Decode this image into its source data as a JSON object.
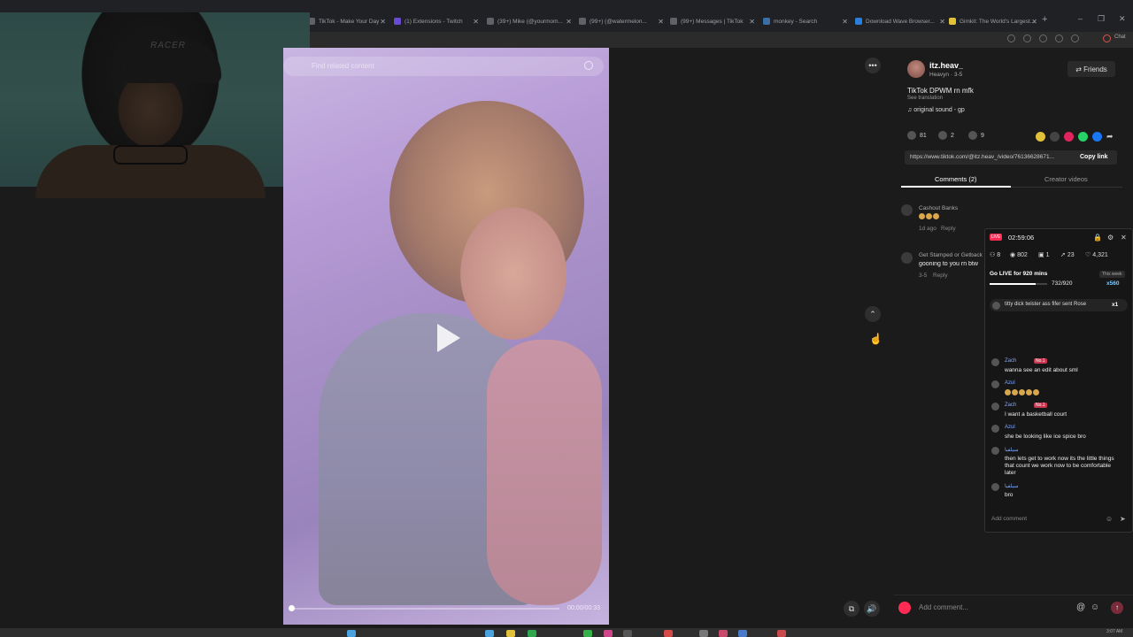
{
  "browser": {
    "tabs": [
      {
        "label": "TikTok - Make Your Day"
      },
      {
        "label": "(1) Extensions - Twitch"
      },
      {
        "label": "(39+) Mike (@yourmom..."
      },
      {
        "label": "(99+) (@watermelon..."
      },
      {
        "label": "(99+) Messages | TikTok"
      },
      {
        "label": "monkey - Search"
      },
      {
        "label": "Download Wave Browser..."
      },
      {
        "label": "Gimkit: The World's Largest..."
      }
    ],
    "new_tab": "+",
    "window_controls": [
      "–",
      "❐",
      "✕"
    ],
    "chat_label": "Chat"
  },
  "webcam": {
    "chair_text": "RACER"
  },
  "video": {
    "search_placeholder": "Find related content",
    "time": "00:00/00:33",
    "progress": 0
  },
  "details": {
    "username": "itz.heav_",
    "nickname": "Heavyn",
    "date": "3-5",
    "friends_label": "Friends",
    "caption": "TikTok DPWM rn mfk",
    "see_translation": "See translation",
    "sound": "original sound - gp",
    "likes": "81",
    "comments_count": "2",
    "saves": "9",
    "link": "https://www.tiktok.com/@itz.heav_/video/76136628671...",
    "copy_link": "Copy link",
    "tab_comments": "Comments (2)",
    "tab_creator": "Creator videos"
  },
  "comments": [
    {
      "name": "Cashout Banks",
      "meta_time": "1d ago",
      "reply": "Reply"
    },
    {
      "name": "Get Stamped or Getback",
      "text": "gooning to you rn btw",
      "meta_time": "3-5",
      "reply": "Reply"
    }
  ],
  "live": {
    "badge": "LIVE",
    "timer": "02:59:06",
    "stats": [
      "8",
      "802",
      "1",
      "23",
      "4,321"
    ],
    "goal": "Go LIVE for 920 mins",
    "goal_progress": "732/920",
    "goal_fraction": 0.7957,
    "week_label": "This week",
    "multiplier": "x560",
    "gift_text": "titty dick twister ass fifer sent Rose",
    "gift_count": "x1",
    "chat": [
      {
        "name": "Zach",
        "badge": "No.1",
        "msg": "wanna see an edit about sml"
      },
      {
        "name": "Azul",
        "msg": ""
      },
      {
        "name": "Zach",
        "badge": "No.1",
        "msg": "I want a basketball court"
      },
      {
        "name": "Azul",
        "msg": "she be looking like ice spice bro"
      },
      {
        "name": "سيلفيا",
        "msg": "then lets get to work now its the little things that count we work now to be comfortable later"
      },
      {
        "name": "سيلفيا",
        "msg": "bro"
      }
    ],
    "comment_placeholder": "Add comment"
  },
  "composer": {
    "placeholder": "Add comment..."
  },
  "taskbar": {
    "time": "3:07 AM"
  },
  "colors": {
    "accent": "#fe2c55",
    "bg": "#1b1b1b",
    "video_tint": "#b79bd6"
  }
}
